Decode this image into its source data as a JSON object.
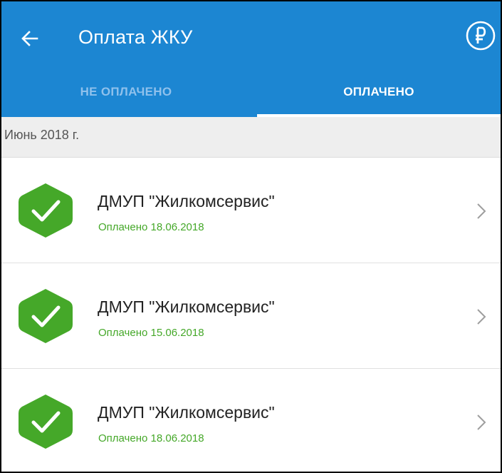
{
  "header": {
    "title": "Оплата ЖКУ",
    "back_icon": "arrow-left-icon",
    "currency_icon": "ruble-circle-icon"
  },
  "tabs": [
    {
      "label": "НЕ ОПЛАЧЕНО",
      "active": false
    },
    {
      "label": "ОПЛАЧЕНО",
      "active": true
    }
  ],
  "section": {
    "label": "Июнь 2018 г."
  },
  "payments": [
    {
      "name": "ДМУП \"Жилкомсервис\"",
      "status": "Оплачено 18.06.2018",
      "icon": "check-badge-icon"
    },
    {
      "name": "ДМУП \"Жилкомсервис\"",
      "status": "Оплачено 15.06.2018",
      "icon": "check-badge-icon"
    },
    {
      "name": "ДМУП \"Жилкомсервис\"",
      "status": "Оплачено 18.06.2018",
      "icon": "check-badge-icon"
    }
  ],
  "colors": {
    "appbar": "#1c86d2",
    "tab_inactive": "#8fc1ec",
    "success_green": "#45a829",
    "section_bg": "#eeeeee"
  }
}
